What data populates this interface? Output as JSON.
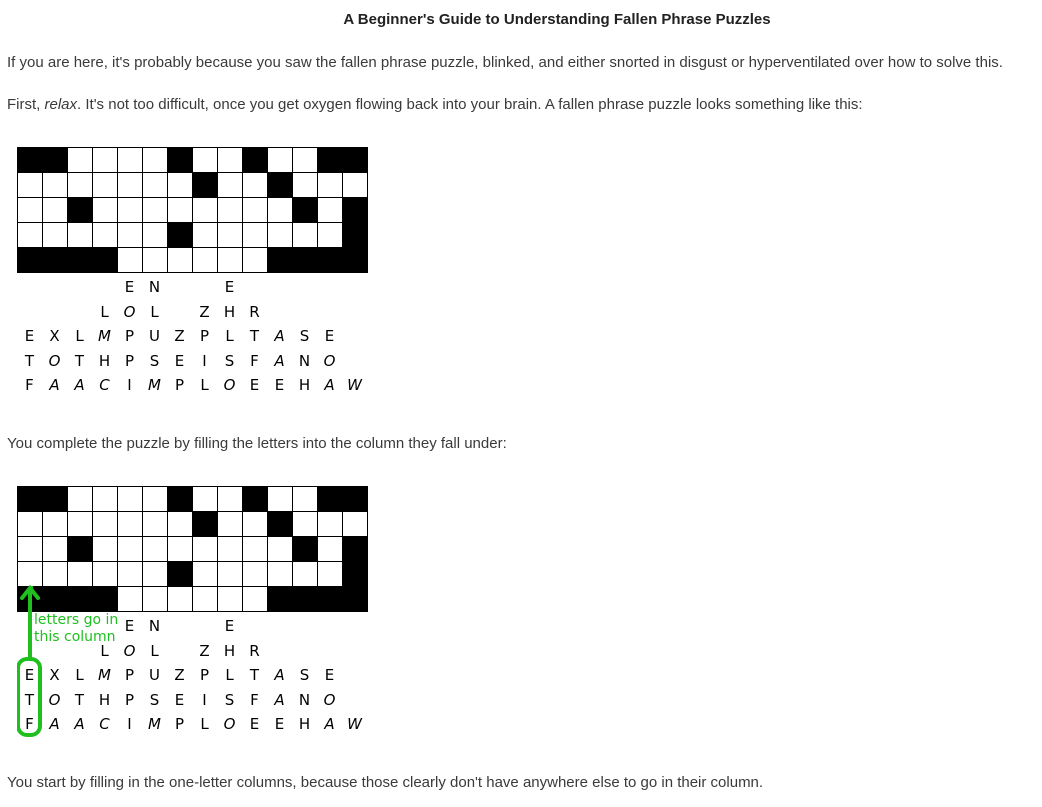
{
  "title": "A Beginner's Guide to Understanding Fallen Phrase Puzzles",
  "paragraphs": [
    "If you are here, it's probably because you saw the fallen phrase puzzle, blinked, and either snorted in disgust or hyperventilated over how to solve this.",
    "It's not too difficult, once you get oxygen flowing back into your brain. A fallen phrase puzzle looks something like this:",
    "You complete the puzzle by filling the letters into the column they fall under:",
    "You start by filling in the one-letter columns, because those clearly don't have anywhere else to go in their column."
  ],
  "para2_prefix": "First, ",
  "para2_em": "relax",
  "para2_after_em": ". ",
  "puzzle": {
    "grid": [
      "BBWWWWBWWBWWBB",
      "WWWWWWWBWWBWWW",
      "WWBWWWWWWWWBWB",
      "WWWWWWBWWWWWWB",
      "BBBBWWWWWWBBBB"
    ],
    "letter_rows": [
      "    EN  E     ",
      "   LOL ZHR    ",
      "EXLMPUZPLTASE ",
      "TOTHPSEISFANO ",
      "FAACIMPLOEEHAW"
    ]
  },
  "annotation": {
    "text_line1": "letters go in",
    "text_line2": "this column",
    "color": "#1fbf1f"
  }
}
